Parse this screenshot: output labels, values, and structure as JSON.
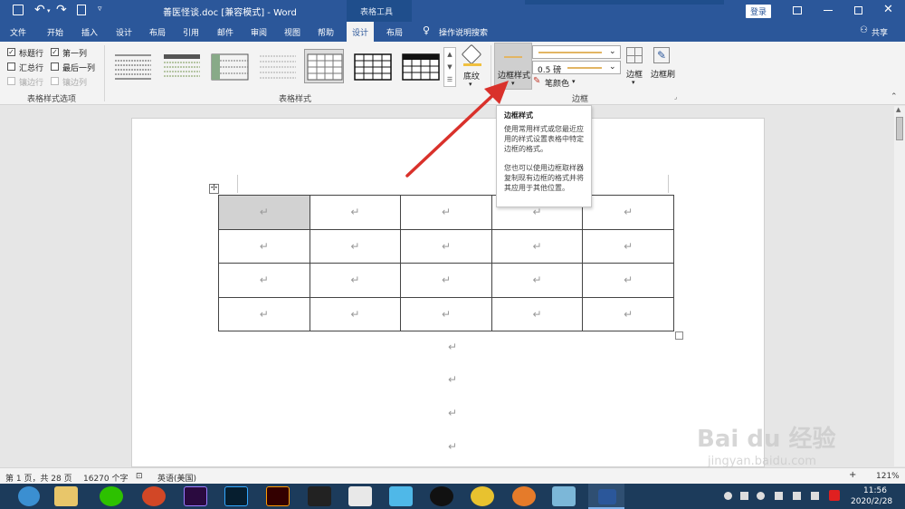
{
  "window": {
    "doc_title": "善医怪谈.doc [兼容模式]  -  Word",
    "context_tab": "表格工具",
    "login_label": "登录"
  },
  "tabs": [
    "文件",
    "开始",
    "插入",
    "设计",
    "布局",
    "引用",
    "邮件",
    "审阅",
    "视图",
    "帮助",
    "设计",
    "布局"
  ],
  "tell_me": "操作说明搜索",
  "share_label": "共享",
  "options": {
    "header_row": "标题行",
    "first_col": "第一列",
    "total_row": "汇总行",
    "last_col": "最后一列",
    "banded_rows": "镶边行",
    "banded_cols": "镶边列",
    "group": "表格样式选项",
    "checked": {
      "header_row": true,
      "first_col": true,
      "total_row": false,
      "last_col": false
    }
  },
  "styles_group": "表格样式",
  "shading_label": "底纹",
  "borders": {
    "border_styles": "边框样式",
    "pen_weight": "0.5 磅",
    "pen_color": "笔颜色",
    "borders_btn": "边框",
    "painter": "边框刷",
    "group": "边框"
  },
  "tooltip": {
    "title": "边框样式",
    "para1": "使用常用样式或您最近应用的样式设置表格中特定边框的格式。",
    "para2": "您也可以使用边框取样器复制现有边框的格式并将其应用于其他位置。"
  },
  "table": {
    "rows": 4,
    "cols": 5,
    "cell_mark": "↵",
    "selected_cell": [
      0,
      0
    ]
  },
  "para_marks": [
    "↵",
    "↵",
    "↵",
    "↵"
  ],
  "status": {
    "page": "第 1 页，共 28 页",
    "words": "16270 个字",
    "lang": "英语(美国)",
    "zoom": "121%"
  },
  "taskbar": {
    "time": "11:56",
    "date": "2020/2/28",
    "accent": "#1c3b5b"
  },
  "watermark": {
    "line1": "Bai du 经验",
    "line2": "jingyan.baidu.com"
  },
  "colors": {
    "word_blue": "#2b579a",
    "arrow_red": "#d9312b",
    "ribbon_bg": "#f3f3f3"
  }
}
